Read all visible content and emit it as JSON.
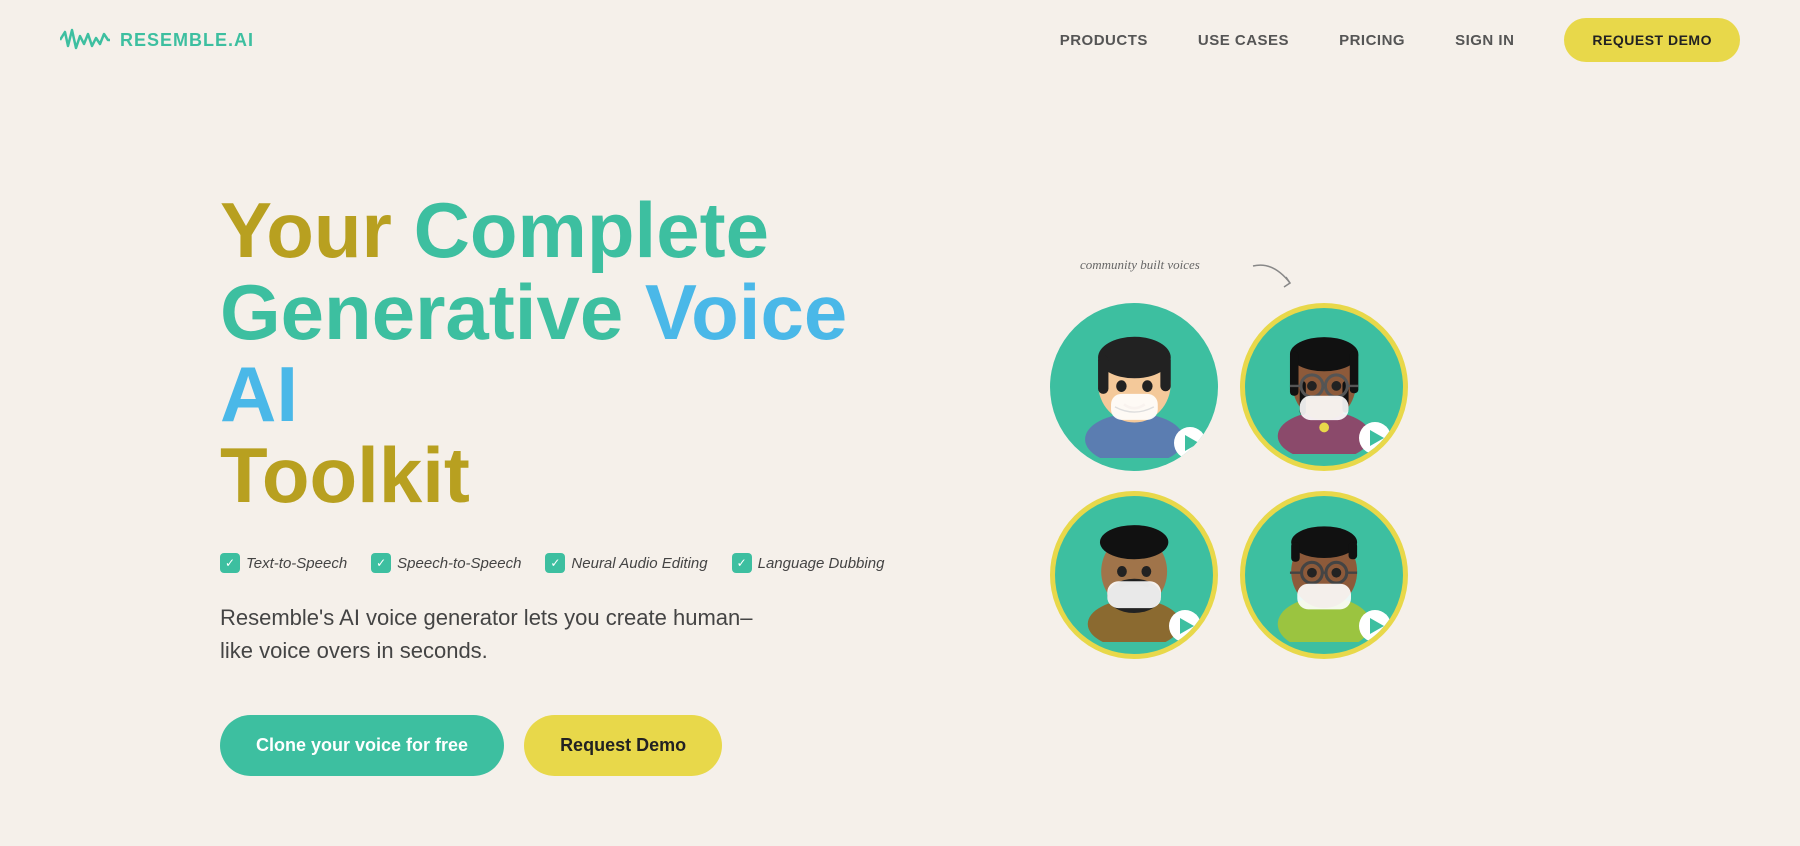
{
  "nav": {
    "logo_text": "RESEMBLE.AI",
    "links": [
      {
        "label": "PRODUCTS",
        "id": "products"
      },
      {
        "label": "USE CASES",
        "id": "use-cases"
      },
      {
        "label": "PRICING",
        "id": "pricing"
      },
      {
        "label": "SIGN IN",
        "id": "sign-in"
      }
    ],
    "cta_label": "REQUEST DEMO"
  },
  "hero": {
    "title_line1_gold": "Your Complete",
    "title_line2_teal": "Generative",
    "title_line2_blue": "Voice AI",
    "title_line3_gold": "Toolkit",
    "features": [
      {
        "label": "Text-to-Speech"
      },
      {
        "label": "Speech-to-Speech"
      },
      {
        "label": "Neural Audio Editing"
      },
      {
        "label": "Language Dubbing"
      }
    ],
    "description": "Resemble's AI voice generator lets you create human–like voice overs in seconds.",
    "cta_primary": "Clone your voice for free",
    "cta_secondary": "Request Demo",
    "community_label": "community built voices"
  }
}
